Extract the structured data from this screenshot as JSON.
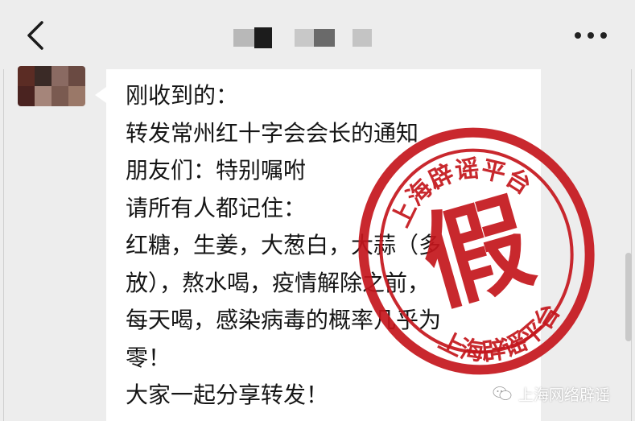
{
  "header": {
    "back_icon": "chevron-left-icon",
    "title_state": "pixelated",
    "menu_icon": "more-dots-icon"
  },
  "message": {
    "avatar_state": "pixelated",
    "text": "刚收到的：\n转发常州红十字会会长的通知\n朋友们：特别嘱咐\n请所有人都记住：\n红糖，生姜，大葱白，大蒜（多\n放），熬水喝，疫情解除之前，\n每天喝，感染病毒的概率几乎为\n零！\n大家一起分享转发！"
  },
  "stamp": {
    "text_top": "上海辟谣平台",
    "text_center": "假",
    "text_bottom": "上海辟谣平台",
    "color": "#c4161c"
  },
  "watermark": {
    "icon": "wechat-icon",
    "text": "上海网络辟谣"
  },
  "colors": {
    "background": "#ededed",
    "bubble": "#ffffff",
    "text": "#151515"
  }
}
